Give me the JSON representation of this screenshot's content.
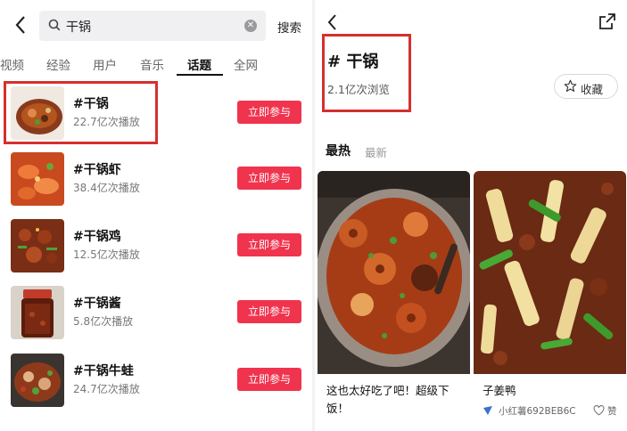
{
  "left": {
    "search": {
      "query": "干锅",
      "button": "搜索"
    },
    "tabs": [
      "视频",
      "经验",
      "用户",
      "音乐",
      "话题",
      "全网"
    ],
    "active_tab": "话题",
    "join_label": "立即参与",
    "results": [
      {
        "title": "#干锅",
        "plays": "22.7亿次播放"
      },
      {
        "title": "#干锅虾",
        "plays": "38.4亿次播放"
      },
      {
        "title": "#干锅鸡",
        "plays": "12.5亿次播放"
      },
      {
        "title": "#干锅酱",
        "plays": "5.8亿次播放"
      },
      {
        "title": "#干锅牛蛙",
        "plays": "24.7亿次播放"
      }
    ]
  },
  "right": {
    "topic_title": "# 干锅",
    "views": "2.1亿次浏览",
    "favorite_label": "收藏",
    "sort": {
      "hot": "最热",
      "new": "最新"
    },
    "cards": [
      {
        "text": "这也太好吃了吧！超级下饭！",
        "author": "",
        "like": ""
      },
      {
        "text": "子姜鸭",
        "author": "小红薯692BEB6C",
        "like": "赞"
      }
    ]
  },
  "colors": {
    "accent": "#f0344e",
    "highlight": "#d6302e"
  }
}
